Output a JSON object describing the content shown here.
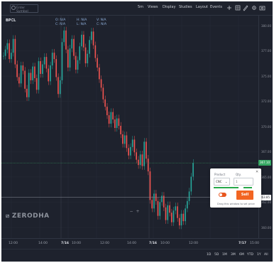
{
  "toolbar": {
    "search_placeholder": "Enter Symbol",
    "items": [
      "5m",
      "Views",
      "Display",
      "Studies",
      "Layout",
      "Events"
    ],
    "icons": [
      "plus-icon",
      "grid-icon",
      "draw-icon",
      "settings-icon",
      "camera-icon"
    ]
  },
  "symbol": "BPCL",
  "ohlc": {
    "o_label": "O:",
    "o_value": "N/A",
    "c_label": "C:",
    "c_value": "N/A",
    "h_label": "H:",
    "h_value": "N/A",
    "l_label": "L:",
    "l_value": "N/A",
    "v_label": "V:",
    "v_value": "N/A",
    "chg_label": "C:",
    "chg_value": "N/A"
  },
  "price_scale": [
    "380.00",
    "377.00",
    "375.00",
    "372.00",
    "370.00",
    "367.00",
    "365.00",
    "362.00",
    "360.00"
  ],
  "current_price": "367.10",
  "crosshair_price": "363.85",
  "time_axis": [
    "12:00",
    "14:00",
    "7/16",
    "10:00",
    "12:00",
    "14:00",
    "7/16",
    "10:00",
    "12:00",
    "7/17",
    "15:00"
  ],
  "logo": "ZERODHA",
  "zoom": {
    "minus": "−",
    "plus": "+"
  },
  "range_buttons": [
    "1D",
    "5D",
    "1M",
    "3M",
    "6M",
    "YTD",
    "1Y",
    "All"
  ],
  "order_panel": {
    "product_label": "Product",
    "product_value": "CNC",
    "qty_label": "Qty.",
    "qty_value": "1",
    "sell_label": "Sell",
    "hint": "Drag this window to set price",
    "close": "✕"
  },
  "chart_data": {
    "type": "candlestick",
    "title": "",
    "xlabel": "",
    "ylabel": "",
    "ylim": [
      360,
      381
    ],
    "up_color": "#26a69a",
    "down_color": "#ef5350",
    "series": [
      {
        "values": [
          377.2,
          377.8,
          378.4,
          376.9,
          377.5,
          378.8,
          376.4,
          375.2,
          374.6,
          376.3,
          375.8,
          374.1,
          373.3,
          375.6,
          374.9,
          376.2,
          375.1,
          374.0,
          376.7,
          375.5,
          376.4,
          377.1,
          376.0,
          374.8,
          376.3,
          377.5,
          376.9,
          375.2,
          373.6,
          374.9,
          378.5,
          379.6,
          377.8,
          376.1,
          377.9,
          378.8,
          377.2,
          375.9,
          376.8,
          378.1,
          379.2,
          378.0,
          376.5,
          377.4,
          378.7,
          379.5,
          378.2,
          377.0,
          376.1,
          375.0,
          374.2,
          373.1,
          372.4,
          371.6,
          370.8,
          371.9,
          371.2,
          370.4,
          371.3,
          370.6,
          369.8,
          368.9,
          369.7,
          368.5,
          367.8,
          368.6,
          369.3,
          368.1,
          367.4,
          366.9,
          367.9,
          366.8,
          369.1,
          367.5,
          366.3,
          363.6,
          362.8,
          364.2,
          363.5,
          362.1,
          363.4,
          364.0,
          362.9,
          361.7,
          363.1,
          362.4,
          361.5,
          362.6,
          363.0,
          361.9,
          361.2,
          362.3,
          361.6,
          362.8,
          363.5,
          364.4,
          365.8,
          367.1
        ]
      }
    ]
  }
}
